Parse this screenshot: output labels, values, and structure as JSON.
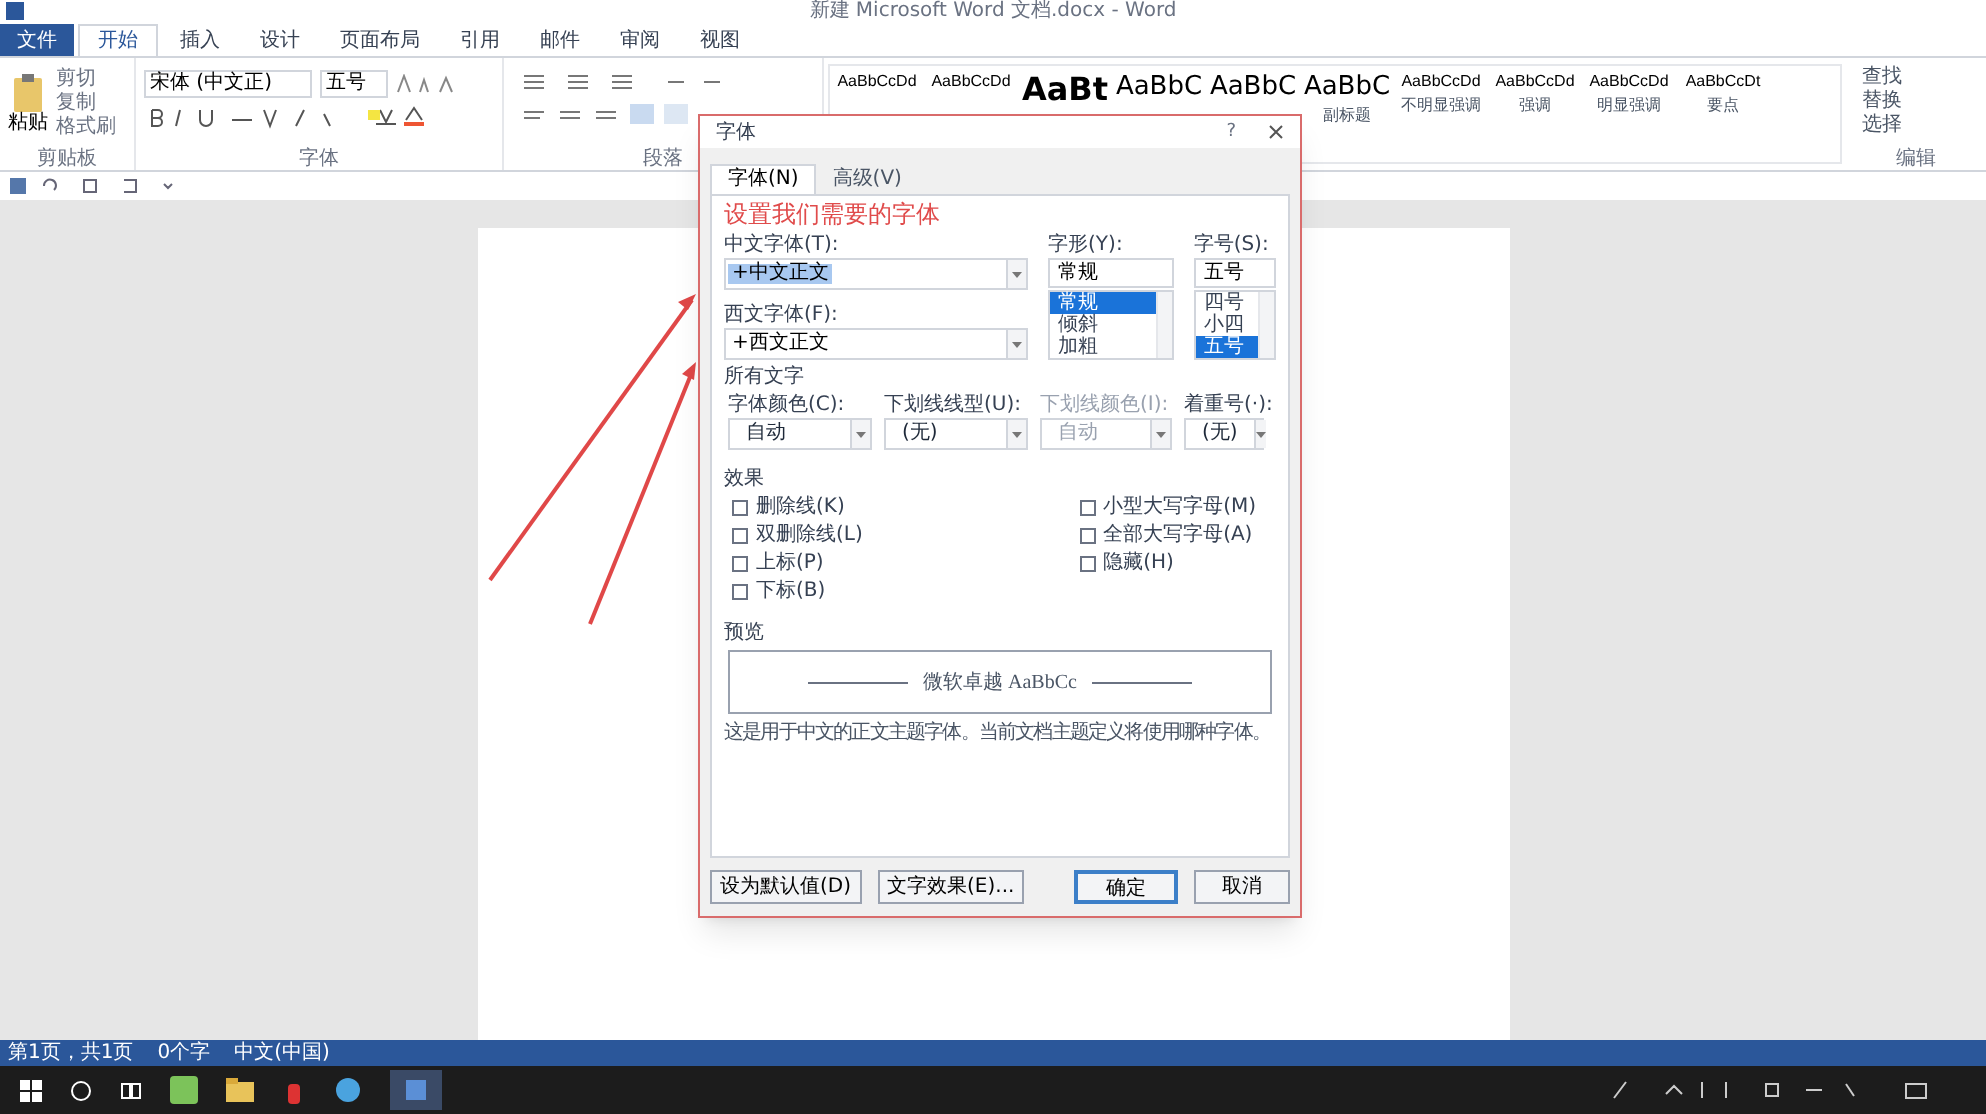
{
  "window": {
    "title": "新建 Microsoft Word 文档.docx - Word"
  },
  "help": "?",
  "file_tab": "文件",
  "tabs": [
    {
      "label": "开始",
      "selected": true
    },
    {
      "label": "插入",
      "selected": false
    },
    {
      "label": "设计",
      "selected": false
    },
    {
      "label": "页面布局",
      "selected": false
    },
    {
      "label": "引用",
      "selected": false
    },
    {
      "label": "邮件",
      "selected": false
    },
    {
      "label": "审阅",
      "selected": false
    },
    {
      "label": "视图",
      "selected": false
    }
  ],
  "ribbon": {
    "clipboard": {
      "paste": "粘贴",
      "items": [
        "剪切",
        "复制",
        "格式刷"
      ],
      "label": "剪贴板"
    },
    "font": {
      "font_name": "宋体 (中文正)",
      "font_size": "五号",
      "label": "字体"
    },
    "paragraph": {
      "label": "段落"
    },
    "styles": [
      {
        "preview": "AaBbCcDd",
        "kind": "small"
      },
      {
        "preview": "AaBbCcDd",
        "kind": "small"
      },
      {
        "preview": "AaBt",
        "kind": "big"
      },
      {
        "preview": "AaBbC",
        "kind": "medium"
      },
      {
        "preview": "AaBbC",
        "kind": "medium"
      },
      {
        "preview": "AaBbC",
        "kind": "medium",
        "name": "副标题"
      },
      {
        "preview": "AaBbCcDd",
        "kind": "small",
        "name": "不明显强调"
      },
      {
        "preview": "AaBbCcDd",
        "kind": "small",
        "name": "强调"
      },
      {
        "preview": "AaBbCcDd",
        "kind": "small",
        "name": "明显强调"
      },
      {
        "preview": "AaBbCcDt",
        "kind": "small",
        "name": "要点"
      }
    ],
    "editing": {
      "items": [
        "查找",
        "替换",
        "选择"
      ],
      "label": "编辑"
    }
  },
  "dialog": {
    "title": "字体",
    "tabs": [
      {
        "label": "字体(N)",
        "selected": true
      },
      {
        "label": "高级(V)",
        "selected": false
      }
    ],
    "annotation": "设置我们需要的字体",
    "chinese_font": {
      "label": "中文字体(T):",
      "value": "+中文正文"
    },
    "western_font": {
      "label": "西文字体(F):",
      "value": "+西文正文"
    },
    "style": {
      "label": "字形(Y):",
      "value": "常规",
      "options": [
        {
          "label": "常规",
          "selected": true
        },
        {
          "label": "倾斜",
          "selected": false
        },
        {
          "label": "加粗",
          "selected": false
        }
      ]
    },
    "size": {
      "label": "字号(S):",
      "value": "五号",
      "options": [
        {
          "label": "四号",
          "selected": false
        },
        {
          "label": "小四",
          "selected": false
        },
        {
          "label": "五号",
          "selected": true
        }
      ]
    },
    "all_text": {
      "label": "所有文字",
      "fields": [
        {
          "label": "字体颜色(C):",
          "value": "自动",
          "disabled": false
        },
        {
          "label": "下划线线型(U):",
          "value": "(无)",
          "disabled": false
        },
        {
          "label": "下划线颜色(I):",
          "value": "自动",
          "disabled": true
        },
        {
          "label": "着重号(·):",
          "value": "(无)",
          "disabled": false
        }
      ]
    },
    "effects": {
      "label": "效果",
      "left": [
        {
          "label": "删除线(K)",
          "checked": false
        },
        {
          "label": "双删除线(L)",
          "checked": false
        },
        {
          "label": "上标(P)",
          "checked": false
        },
        {
          "label": "下标(B)",
          "checked": false
        }
      ],
      "right": [
        {
          "label": "小型大写字母(M)",
          "checked": false
        },
        {
          "label": "全部大写字母(A)",
          "checked": false
        },
        {
          "label": "隐藏(H)",
          "checked": false
        }
      ]
    },
    "preview": {
      "label": "预览",
      "sample": "微软卓越 AaBbCc",
      "note": "这是用于中文的正文主题字体。当前文档主题定义将使用哪种字体。"
    },
    "buttons": [
      "设为默认值(D)",
      "文字效果(E)...",
      "确定",
      "取消"
    ]
  },
  "status_bar": [
    "第1页，共1页",
    "0个字",
    "中文(中国)"
  ]
}
